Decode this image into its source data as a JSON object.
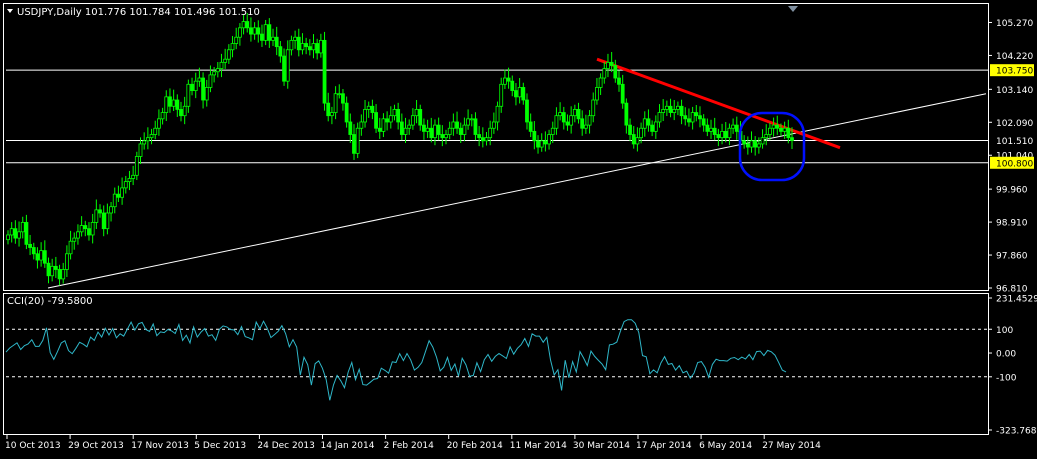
{
  "header": {
    "symbol_line": "USDJPY,Daily  101.776 101.784 101.496 101.510",
    "indicator_line": "CCI(20) -79.5800"
  },
  "colors": {
    "background": "#000000",
    "grid_and_axes": "#ffffff",
    "bull_candle": "#00ff00",
    "bear_candle": "#00ff00",
    "cci_line": "#2fb7c9",
    "resistance_line": "#ff0000",
    "highlight_circle": "#0010ff",
    "price_badge_bg": "#ffff00"
  },
  "chart_data": [
    {
      "type": "candlestick",
      "title": "USDJPY,Daily",
      "ohlc_current": {
        "open": 101.776,
        "high": 101.784,
        "low": 101.496,
        "close": 101.51
      },
      "ylim": [
        96.81,
        105.795
      ],
      "y_ticks": [
        "105.270",
        "104.220",
        "103.140",
        "102.090",
        "101.040",
        "99.960",
        "98.910",
        "97.860",
        "96.810"
      ],
      "price_labels": [
        {
          "value": 103.75,
          "text": "103.750",
          "style": "badge"
        },
        {
          "value": 101.51,
          "text": "101.510",
          "style": "plain"
        },
        {
          "value": 100.8,
          "text": "100.800",
          "style": "badge"
        }
      ],
      "horizontal_levels": [
        103.75,
        101.51,
        100.8
      ],
      "x_labels": [
        "10 Oct 2013",
        "29 Oct 2013",
        "17 Nov 2013",
        "5 Dec 2013",
        "24 Dec 2013",
        "14 Jan 2014",
        "2 Feb 2014",
        "20 Feb 2014",
        "11 Mar 2014",
        "30 Mar 2014",
        "17 Apr 2014",
        "6 May 2014",
        "27 May 2014"
      ],
      "trendlines": [
        {
          "name": "support",
          "from": {
            "date": "Oct 2013",
            "value": 96.81
          },
          "to": {
            "date": "Jun 2014",
            "value": 103.0
          },
          "color": "#ffffff"
        },
        {
          "name": "resistance",
          "from": {
            "date": "4 Apr 2014",
            "value": 104.1
          },
          "to": {
            "date": "15 Jun 2014",
            "value": 101.28
          },
          "color": "#ff0000"
        }
      ],
      "closes": [
        98.5,
        98.7,
        98.4,
        98.6,
        98.9,
        98.2,
        98.1,
        97.9,
        97.7,
        98.0,
        97.6,
        97.2,
        97.5,
        97.4,
        97.1,
        97.4,
        97.9,
        98.3,
        98.4,
        98.6,
        98.8,
        98.7,
        98.5,
        98.9,
        99.3,
        99.2,
        98.7,
        99.2,
        99.4,
        99.8,
        99.7,
        100.0,
        100.2,
        100.3,
        100.4,
        101.0,
        101.4,
        101.5,
        101.6,
        101.7,
        101.9,
        102.2,
        102.4,
        102.9,
        102.6,
        102.8,
        102.5,
        102.3,
        102.6,
        103.3,
        103.1,
        103.4,
        103.5,
        102.8,
        103.2,
        103.6,
        103.7,
        103.8,
        104.0,
        104.1,
        104.4,
        104.6,
        104.8,
        105.1,
        105.3,
        105.1,
        104.9,
        105.1,
        104.9,
        104.7,
        105.2,
        104.7,
        104.8,
        104.5,
        104.2,
        103.4,
        104.4,
        104.7,
        104.8,
        104.4,
        104.6,
        104.5,
        104.4,
        104.6,
        104.3,
        104.7,
        102.7,
        102.3,
        102.4,
        103.0,
        103.0,
        102.7,
        102.1,
        101.7,
        101.1,
        101.9,
        102.1,
        102.5,
        102.6,
        102.4,
        101.9,
        101.8,
        102.2,
        102.1,
        102.3,
        102.5,
        102.1,
        101.7,
        101.9,
        102.0,
        102.3,
        102.5,
        102.0,
        101.8,
        101.9,
        101.6,
        102.0,
        101.7,
        101.6,
        101.7,
        101.9,
        102.1,
        101.9,
        101.7,
        102.0,
        102.2,
        102.2,
        101.7,
        101.6,
        101.5,
        101.6,
        101.9,
        102.1,
        102.6,
        103.3,
        103.5,
        103.4,
        103.1,
        102.9,
        103.2,
        102.8,
        102.1,
        101.8,
        101.5,
        101.3,
        101.5,
        101.4,
        101.7,
        101.9,
        102.3,
        102.4,
        102.1,
        102.0,
        102.3,
        102.5,
        102.2,
        101.9,
        102.0,
        102.3,
        102.8,
        103.2,
        103.5,
        103.8,
        104.0,
        103.9,
        103.5,
        103.3,
        102.7,
        102.0,
        101.7,
        101.4,
        101.6,
        101.9,
        102.2,
        102.0,
        101.8,
        102.1,
        102.4,
        102.5,
        102.6,
        102.4,
        102.5,
        102.6,
        102.3,
        102.2,
        102.1,
        102.4,
        102.3,
        102.2,
        102.0,
        101.8,
        101.9,
        101.7,
        101.6,
        101.8,
        101.6,
        101.9,
        102.0,
        101.8,
        101.5,
        101.4,
        101.3,
        101.5,
        101.3,
        101.4,
        101.6,
        101.7,
        101.9,
        102.0,
        101.9,
        101.8,
        101.9,
        101.6,
        101.51
      ]
    },
    {
      "type": "line",
      "title": "CCI(20)",
      "current_value": -79.58,
      "ylim": [
        -323.768,
        231.4529
      ],
      "y_ticks": [
        "231.4529",
        "100",
        "0.00",
        "-100",
        "-323.768"
      ],
      "dashed_levels": [
        100,
        -100
      ],
      "values": [
        4,
        21,
        32,
        43,
        15,
        31,
        38,
        56,
        28,
        28,
        53,
        106,
        2,
        -27,
        6,
        42,
        52,
        10,
        -3,
        20,
        45,
        37,
        26,
        67,
        53,
        88,
        67,
        104,
        76,
        103,
        64,
        81,
        71,
        101,
        130,
        96,
        123,
        129,
        99,
        91,
        122,
        73,
        89,
        86,
        99,
        93,
        82,
        120,
        53,
        75,
        42,
        110,
        67,
        88,
        103,
        71,
        77,
        53,
        100,
        114,
        110,
        99,
        97,
        77,
        111,
        69,
        64,
        56,
        130,
        102,
        134,
        105,
        65,
        78,
        92,
        115,
        82,
        26,
        56,
        25,
        -93,
        -18,
        -49,
        -135,
        -45,
        -33,
        -64,
        -110,
        -199,
        -134,
        -94,
        -117,
        -146,
        -80,
        -40,
        -112,
        -68,
        -133,
        -135,
        -123,
        -110,
        -107,
        -64,
        -73,
        -85,
        -37,
        -40,
        -3,
        -32,
        -2,
        -29,
        -72,
        -60,
        -40,
        5,
        52,
        25,
        -17,
        -75,
        -59,
        -19,
        -73,
        -46,
        -97,
        -22,
        -49,
        -98,
        -94,
        -41,
        -78,
        -28,
        -6,
        -35,
        -14,
        -2,
        -12,
        -23,
        26,
        -5,
        20,
        35,
        61,
        28,
        81,
        71,
        71,
        45,
        66,
        -29,
        -92,
        -70,
        -157,
        -30,
        -104,
        -36,
        -80,
        6,
        -21,
        -53,
        8,
        -14,
        -31,
        -46,
        -70,
        34,
        37,
        46,
        92,
        132,
        140,
        140,
        125,
        86,
        -11,
        -16,
        -87,
        -71,
        -83,
        -42,
        -15,
        -48,
        -44,
        -72,
        -53,
        -83,
        -76,
        -106,
        -85,
        -40,
        -36,
        -60,
        -102,
        -48,
        -26,
        -32,
        -32,
        -34,
        -22,
        -19,
        -28,
        -17,
        -25,
        -6,
        -28,
        6,
        8,
        -11,
        11,
        5,
        -9,
        -39,
        -72,
        -79.58
      ]
    }
  ]
}
